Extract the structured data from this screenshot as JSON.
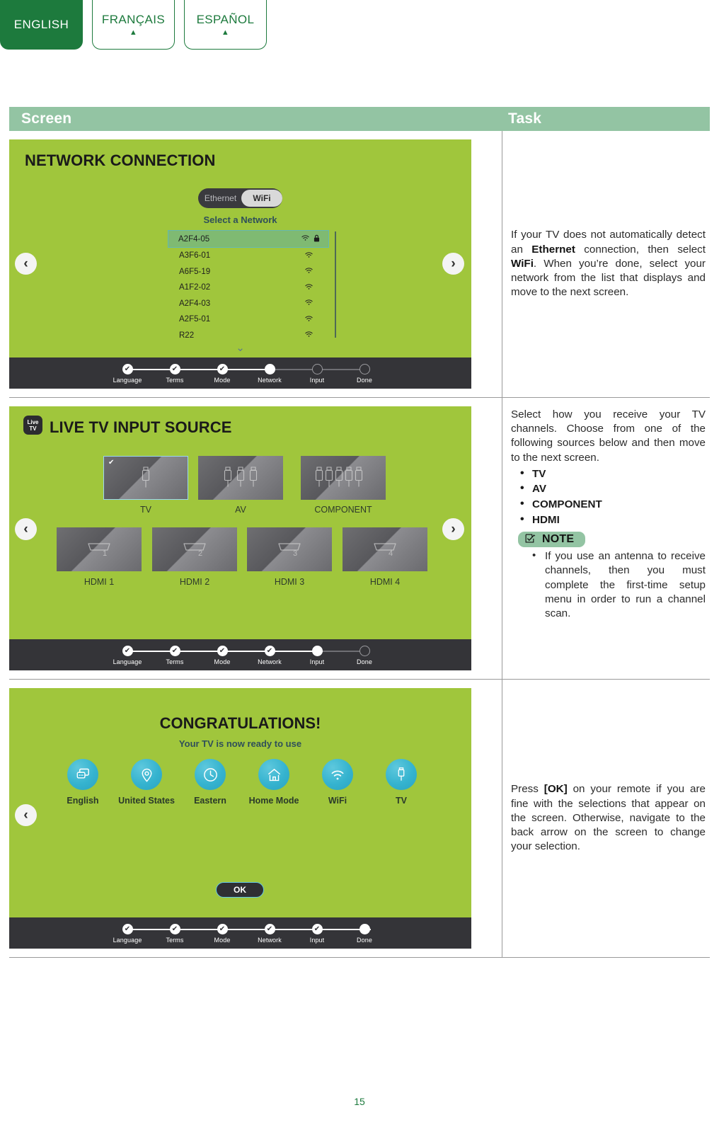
{
  "language_tabs": [
    {
      "label": "ENGLISH",
      "active": true,
      "caret": ""
    },
    {
      "label": "FRANÇAIS",
      "active": false,
      "caret": "▲"
    },
    {
      "label": "ESPAÑOL",
      "active": false,
      "caret": "▲"
    }
  ],
  "table": {
    "headers": {
      "screen": "Screen",
      "task": "Task"
    }
  },
  "row1": {
    "screen": {
      "title": "NETWORK CONNECTION",
      "toggle": {
        "ethernet_label": "Ethernet",
        "wifi_label": "WiFi",
        "selected": "WiFi"
      },
      "select_network_label": "Select a Network",
      "networks": [
        {
          "ssid": "A2F4-05",
          "wifi_icon": "wifi-icon",
          "locked": true,
          "selected": true
        },
        {
          "ssid": "A3F6-01",
          "wifi_icon": "wifi-icon",
          "locked": false,
          "selected": false
        },
        {
          "ssid": "A6F5-19",
          "wifi_icon": "wifi-icon",
          "locked": false,
          "selected": false
        },
        {
          "ssid": "A1F2-02",
          "wifi_icon": "wifi-icon",
          "locked": false,
          "selected": false
        },
        {
          "ssid": "A2F4-03",
          "wifi_icon": "wifi-icon",
          "locked": false,
          "selected": false
        },
        {
          "ssid": "A2F5-01",
          "wifi_icon": "wifi-icon",
          "locked": false,
          "selected": false
        },
        {
          "ssid": "R22",
          "wifi_icon": "wifi-icon",
          "locked": false,
          "selected": false
        }
      ],
      "scroll_down_icon": "chevron-down-icon",
      "nav_prev_icon": "chevron-left-icon",
      "nav_next_icon": "chevron-right-icon",
      "progress": [
        {
          "label": "Language",
          "state": "check"
        },
        {
          "label": "Terms",
          "state": "check"
        },
        {
          "label": "Mode",
          "state": "check"
        },
        {
          "label": "Network",
          "state": "current"
        },
        {
          "label": "Input",
          "state": "empty"
        },
        {
          "label": "Done",
          "state": "empty"
        }
      ]
    },
    "task": {
      "p1": "If your TV does not automatically detect an ",
      "b1": "Ethernet",
      "p2": " connection, then select ",
      "b2": "WiFi",
      "p3": ". When you’re done, select your network from the list that displays and move to the next screen."
    }
  },
  "row2": {
    "screen": {
      "badge_line1": "Live",
      "badge_line2": "TV",
      "title": "LIVE TV INPUT SOURCE",
      "tiles_top": [
        {
          "label": "TV",
          "icon": "rca-connector-icon",
          "selected": true
        },
        {
          "label": "AV",
          "icon": "av-connectors-icon",
          "selected": false
        },
        {
          "label": "COMPONENT",
          "icon": "component-connectors-icon",
          "selected": false
        }
      ],
      "tiles_bottom": [
        {
          "label": "HDMI 1",
          "icon": "hdmi-port-icon",
          "number": "1"
        },
        {
          "label": "HDMI 2",
          "icon": "hdmi-port-icon",
          "number": "2"
        },
        {
          "label": "HDMI 3",
          "icon": "hdmi-port-icon",
          "number": "3"
        },
        {
          "label": "HDMI 4",
          "icon": "hdmi-port-icon",
          "number": "4"
        }
      ],
      "nav_prev_icon": "chevron-left-icon",
      "nav_next_icon": "chevron-right-icon",
      "progress": [
        {
          "label": "Language",
          "state": "check"
        },
        {
          "label": "Terms",
          "state": "check"
        },
        {
          "label": "Mode",
          "state": "check"
        },
        {
          "label": "Network",
          "state": "check"
        },
        {
          "label": "Input",
          "state": "current"
        },
        {
          "label": "Done",
          "state": "empty"
        }
      ]
    },
    "task": {
      "intro": "Select how you receive your TV channels. Choose from one of the following sources below and then move to the next screen.",
      "bullets": [
        "TV",
        "AV",
        "COMPONENT",
        "HDMI"
      ],
      "note_icon": "checkbox-pencil-icon",
      "note_label": "NOTE",
      "note_items": [
        "If you use an antenna to receive channels, then you must complete the first-time setup menu in order to run a channel scan."
      ]
    }
  },
  "row3": {
    "screen": {
      "title": "CONGRATULATIONS!",
      "subtitle": "Your TV is now ready to use",
      "summary": [
        {
          "label": "English",
          "icon": "chat-bubbles-icon"
        },
        {
          "label": "United States",
          "icon": "location-pin-icon"
        },
        {
          "label": "Eastern",
          "icon": "clock-icon"
        },
        {
          "label": "Home Mode",
          "icon": "home-icon"
        },
        {
          "label": "WiFi",
          "icon": "wifi-icon"
        },
        {
          "label": "TV",
          "icon": "rca-connector-icon"
        }
      ],
      "ok_label": "OK",
      "nav_prev_icon": "chevron-left-icon",
      "progress": [
        {
          "label": "Language",
          "state": "check"
        },
        {
          "label": "Terms",
          "state": "check"
        },
        {
          "label": "Mode",
          "state": "check"
        },
        {
          "label": "Network",
          "state": "check"
        },
        {
          "label": "Input",
          "state": "check"
        },
        {
          "label": "Done",
          "state": "current"
        }
      ]
    },
    "task": {
      "p1": "Press ",
      "b1": "[OK]",
      "p2": " on your remote if you are fine with the selections that appear on the screen. Otherwise, navigate to the back arrow on the screen to change your selection."
    }
  },
  "page_number": "15",
  "colors": {
    "brand_green": "#1d7a3d",
    "header_sage": "#93c4a3",
    "tv_green": "#a0c63c",
    "dark_bar": "#343438",
    "accent_cyan": "#63c8e8",
    "summary_blue": "#35b3cf"
  }
}
